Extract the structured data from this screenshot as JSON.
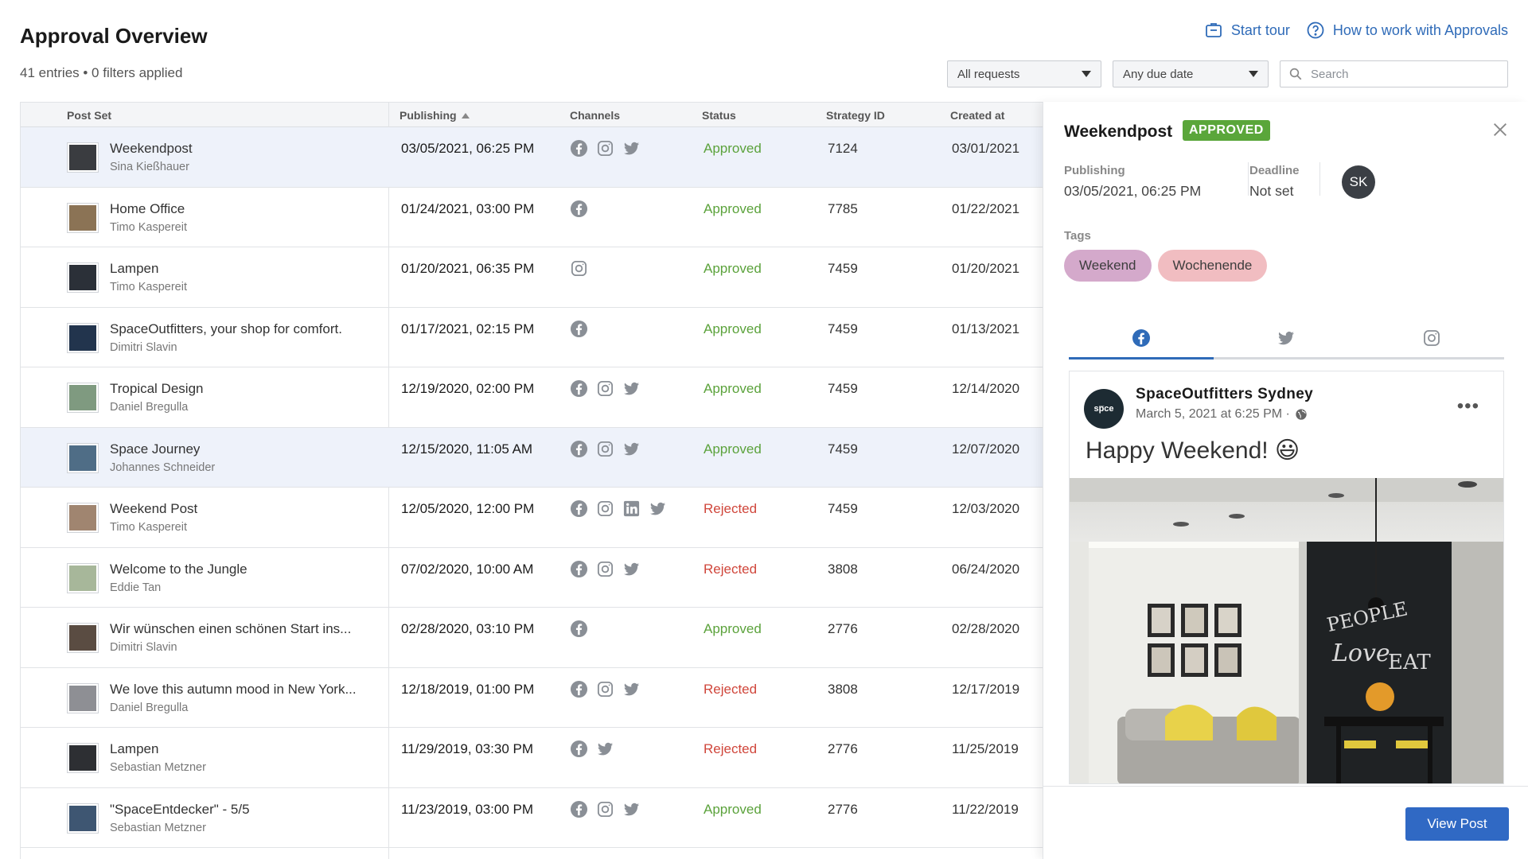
{
  "header": {
    "title": "Approval Overview",
    "subtitle": "41 entries • 0 filters applied",
    "start_tour": "Start tour",
    "help": "How to work with Approvals"
  },
  "filters": {
    "requests": "All requests",
    "due_date": "Any due date",
    "search_placeholder": "Search"
  },
  "table": {
    "columns": [
      "Post Set",
      "Publishing",
      "Channels",
      "Status",
      "Strategy ID",
      "Created at"
    ],
    "rows": [
      {
        "title": "Weekendpost",
        "author": "Sina Kießhauer",
        "publishing": "03/05/2021, 06:25 PM",
        "channels": [
          "facebook",
          "instagram",
          "twitter"
        ],
        "status": "Approved",
        "strategy_id": "7124",
        "created": "03/01/2021",
        "selected": true,
        "thumb": "#3a3c40"
      },
      {
        "title": "Home Office",
        "author": "Timo Kaspereit",
        "publishing": "01/24/2021, 03:00 PM",
        "channels": [
          "facebook"
        ],
        "status": "Approved",
        "strategy_id": "7785",
        "created": "01/22/2021",
        "selected": false,
        "thumb": "#8b7355"
      },
      {
        "title": "Lampen",
        "author": "Timo Kaspereit",
        "publishing": "01/20/2021, 06:35 PM",
        "channels": [
          "instagram"
        ],
        "status": "Approved",
        "strategy_id": "7459",
        "created": "01/20/2021",
        "selected": false,
        "thumb": "#2b3038"
      },
      {
        "title": "SpaceOutfitters, your shop for comfort.",
        "author": "Dimitri Slavin",
        "publishing": "01/17/2021, 02:15 PM",
        "channels": [
          "facebook"
        ],
        "status": "Approved",
        "strategy_id": "7459",
        "created": "01/13/2021",
        "selected": false,
        "thumb": "#22344d"
      },
      {
        "title": "Tropical Design",
        "author": "Daniel Bregulla",
        "publishing": "12/19/2020, 02:00 PM",
        "channels": [
          "facebook",
          "instagram",
          "twitter"
        ],
        "status": "Approved",
        "strategy_id": "7459",
        "created": "12/14/2020",
        "selected": false,
        "thumb": "#7f9a80"
      },
      {
        "title": "Space Journey",
        "author": "Johannes Schneider",
        "publishing": "12/15/2020, 11:05 AM",
        "channels": [
          "facebook",
          "instagram",
          "twitter"
        ],
        "status": "Approved",
        "strategy_id": "7459",
        "created": "12/07/2020",
        "selected": true,
        "thumb": "#4f6d86"
      },
      {
        "title": "Weekend Post",
        "author": "Timo Kaspereit",
        "publishing": "12/05/2020, 12:00 PM",
        "channels": [
          "facebook",
          "instagram",
          "linkedin",
          "twitter"
        ],
        "status": "Rejected",
        "strategy_id": "7459",
        "created": "12/03/2020",
        "selected": false,
        "thumb": "#a08570"
      },
      {
        "title": "Welcome to the Jungle",
        "author": "Eddie Tan",
        "publishing": "07/02/2020, 10:00 AM",
        "channels": [
          "facebook",
          "instagram",
          "twitter"
        ],
        "status": "Rejected",
        "strategy_id": "3808",
        "created": "06/24/2020",
        "selected": false,
        "thumb": "#a7b79a"
      },
      {
        "title": "Wir wünschen einen schönen Start ins...",
        "author": "Dimitri Slavin",
        "publishing": "02/28/2020, 03:10 PM",
        "channels": [
          "facebook"
        ],
        "status": "Approved",
        "strategy_id": "2776",
        "created": "02/28/2020",
        "selected": false,
        "thumb": "#5a4c42"
      },
      {
        "title": "We love this autumn mood in New York...",
        "author": "Daniel Bregulla",
        "publishing": "12/18/2019, 01:00 PM",
        "channels": [
          "facebook",
          "instagram",
          "twitter"
        ],
        "status": "Rejected",
        "strategy_id": "3808",
        "created": "12/17/2019",
        "selected": false,
        "thumb": "#8e8f94"
      },
      {
        "title": "Lampen",
        "author": "Sebastian Metzner",
        "publishing": "11/29/2019, 03:30 PM",
        "channels": [
          "facebook",
          "twitter"
        ],
        "status": "Rejected",
        "strategy_id": "2776",
        "created": "11/25/2019",
        "selected": false,
        "thumb": "#2d2f33"
      },
      {
        "title": "\"SpaceEntdecker\" - 5/5",
        "author": "Sebastian Metzner",
        "publishing": "11/23/2019, 03:00 PM",
        "channels": [
          "facebook",
          "instagram",
          "twitter"
        ],
        "status": "Approved",
        "strategy_id": "2776",
        "created": "11/22/2019",
        "selected": false,
        "thumb": "#3e5672"
      }
    ]
  },
  "panel": {
    "title": "Weekendpost",
    "badge": "APPROVED",
    "publishing_label": "Publishing",
    "publishing_value": "03/05/2021, 06:25 PM",
    "deadline_label": "Deadline",
    "deadline_value": "Not set",
    "avatar": "SK",
    "tags_label": "Tags",
    "tags": [
      "Weekend",
      "Wochenende"
    ],
    "preview": {
      "avatar_text": "sp̅ce",
      "page_name": "SpaceOutfitters Sydney",
      "date": "March 5, 2021 at 6:25 PM ·",
      "text": "Happy Weekend! 😃",
      "more": "•••"
    },
    "view_post": "View Post"
  },
  "colors": {
    "approved": "#5ba23b",
    "rejected": "#d0463b",
    "accent": "#3069c4",
    "link": "#2f6bb8"
  }
}
